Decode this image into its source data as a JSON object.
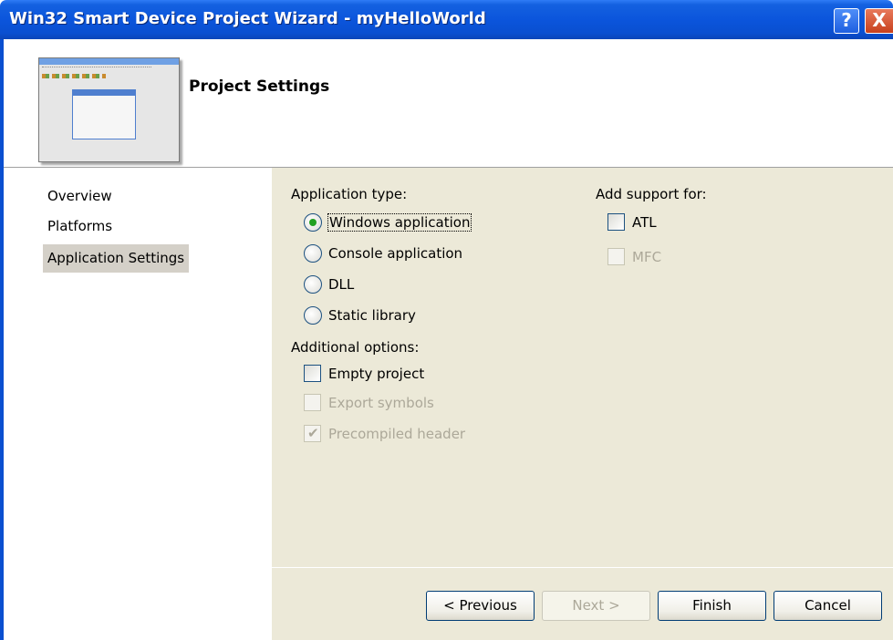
{
  "window": {
    "title": "Win32 Smart Device Project Wizard - myHelloWorld",
    "help_button": "?",
    "close_button": "X"
  },
  "header": {
    "title": "Project Settings"
  },
  "nav": {
    "items": [
      {
        "label": "Overview",
        "selected": false
      },
      {
        "label": "Platforms",
        "selected": false
      },
      {
        "label": "Application Settings",
        "selected": true
      }
    ]
  },
  "application_type": {
    "label": "Application type:",
    "options": [
      {
        "label": "Windows application",
        "selected": true
      },
      {
        "label": "Console application",
        "selected": false
      },
      {
        "label": "DLL",
        "selected": false
      },
      {
        "label": "Static library",
        "selected": false
      }
    ]
  },
  "additional_options": {
    "label": "Additional options:",
    "options": [
      {
        "label": "Empty project",
        "checked": false,
        "enabled": true
      },
      {
        "label": "Export symbols",
        "checked": false,
        "enabled": false
      },
      {
        "label": "Precompiled header",
        "checked": true,
        "enabled": false
      }
    ]
  },
  "add_support": {
    "label": "Add support for:",
    "options": [
      {
        "label": "ATL",
        "checked": false,
        "enabled": true
      },
      {
        "label": "MFC",
        "checked": false,
        "enabled": false
      }
    ]
  },
  "buttons": {
    "previous": "< Previous",
    "next": "Next >",
    "finish": "Finish",
    "cancel": "Cancel"
  },
  "colors": {
    "titlebar": "#0b55dc",
    "content_bg": "#ece9d8",
    "radio_dot": "#21a121"
  }
}
